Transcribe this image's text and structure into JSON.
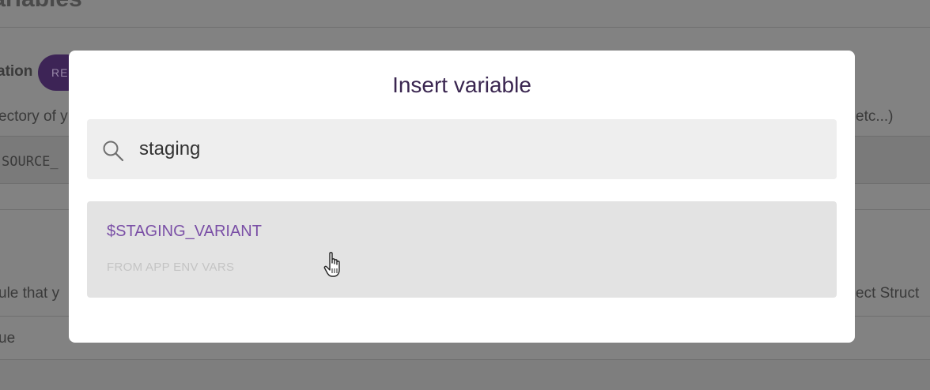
{
  "background": {
    "heading": "Variables",
    "section_label": "ation",
    "chip_label": "RE",
    "line_left_1": "ectory of y",
    "line_right_1": "etc...)",
    "code_left": "SOURCE_",
    "line_left_2": "ule that y",
    "line_right_2": "ect Struct",
    "line_left_3": "ue"
  },
  "modal": {
    "title": "Insert variable",
    "search": {
      "value": "staging",
      "icon": "search-icon"
    },
    "results": [
      {
        "name": "$STAGING_VARIANT",
        "source": "FROM APP ENV VARS"
      }
    ]
  },
  "colors": {
    "accent": "#7a4fa6",
    "title": "#3a2650",
    "overlay": "#828282"
  }
}
